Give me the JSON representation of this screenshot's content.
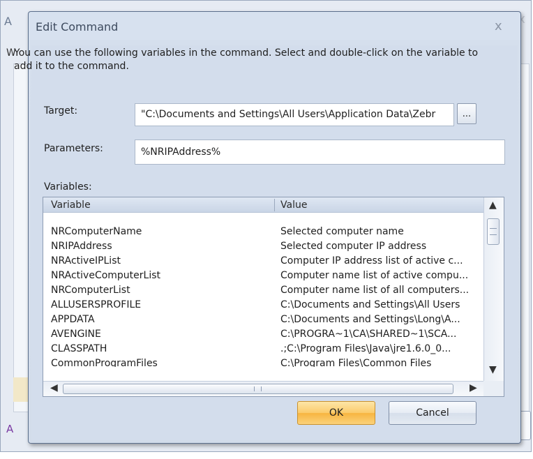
{
  "background_window": {
    "title_fragment": "A",
    "close_glyph": "x",
    "side_letter_top": "W",
    "side_letter_bottom": "A"
  },
  "dialog": {
    "title": "Edit Command",
    "close_glyph": "x",
    "description": "You can use the following variables in the command. Select and double-click on the variable to add it to the command.",
    "target": {
      "label": "Target:",
      "value": "\"C:\\Documents and Settings\\All Users\\Application Data\\Zebr",
      "browse_label": "..."
    },
    "parameters": {
      "label": "Parameters:",
      "value": "%NRIPAddress%"
    },
    "variables_label": "Variables:",
    "list": {
      "columns": [
        "Variable",
        "Value"
      ],
      "rows": [
        {
          "variable": "NRComputerName",
          "value": "Selected computer name"
        },
        {
          "variable": "NRIPAddress",
          "value": "Selected computer IP address"
        },
        {
          "variable": "NRActiveIPList",
          "value": "Computer IP address list of active c..."
        },
        {
          "variable": "NRActiveComputerList",
          "value": "Computer name list of active compu..."
        },
        {
          "variable": "NRComputerList",
          "value": "Computer name list of all computers..."
        },
        {
          "variable": "ALLUSERSPROFILE",
          "value": "C:\\Documents and Settings\\All Users"
        },
        {
          "variable": "APPDATA",
          "value": "C:\\Documents and Settings\\Long\\A..."
        },
        {
          "variable": "AVENGINE",
          "value": "C:\\PROGRA~1\\CA\\SHARED~1\\SCA..."
        },
        {
          "variable": "CLASSPATH",
          "value": ".;C:\\Program Files\\Java\\jre1.6.0_0..."
        },
        {
          "variable": "CommonProgramFiles",
          "value": "C:\\Program Files\\Common Files"
        }
      ],
      "scroll": {
        "up_glyph": "▲",
        "down_glyph": "▼",
        "left_glyph": "◀",
        "right_glyph": "▶"
      }
    },
    "buttons": {
      "ok_label": "OK",
      "cancel_label": "Cancel"
    }
  },
  "colors": {
    "dialog_background": "#d3ddec",
    "ok_button": "#fbcb6b",
    "border": "#5b6e8c"
  }
}
